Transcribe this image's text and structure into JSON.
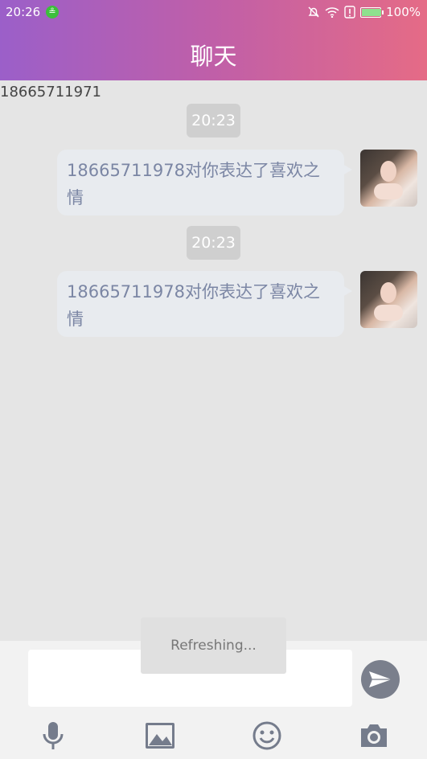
{
  "status_bar": {
    "time": "20:26",
    "battery_text": "100%",
    "battery_level": 1.0,
    "icons": [
      "wechat-icon",
      "mute-icon",
      "wifi-icon",
      "alert-icon",
      "battery-icon"
    ]
  },
  "header": {
    "title": "聊天"
  },
  "contact": {
    "phone": "18665711971"
  },
  "messages": [
    {
      "time": "20:23",
      "text": "18665711978对你表达了喜欢之情"
    },
    {
      "time": "20:23",
      "text": "18665711978对你表达了喜欢之情"
    }
  ],
  "toast": {
    "text": "Refreshing..."
  },
  "composer": {
    "value": "",
    "icons": [
      "microphone-icon",
      "image-icon",
      "emoji-icon",
      "camera-icon",
      "send-icon"
    ]
  },
  "colors": {
    "header_start": "#9b5fc9",
    "header_end": "#e56b86",
    "bubble": "#e8ebef",
    "bubble_text": "#7b86a4"
  }
}
